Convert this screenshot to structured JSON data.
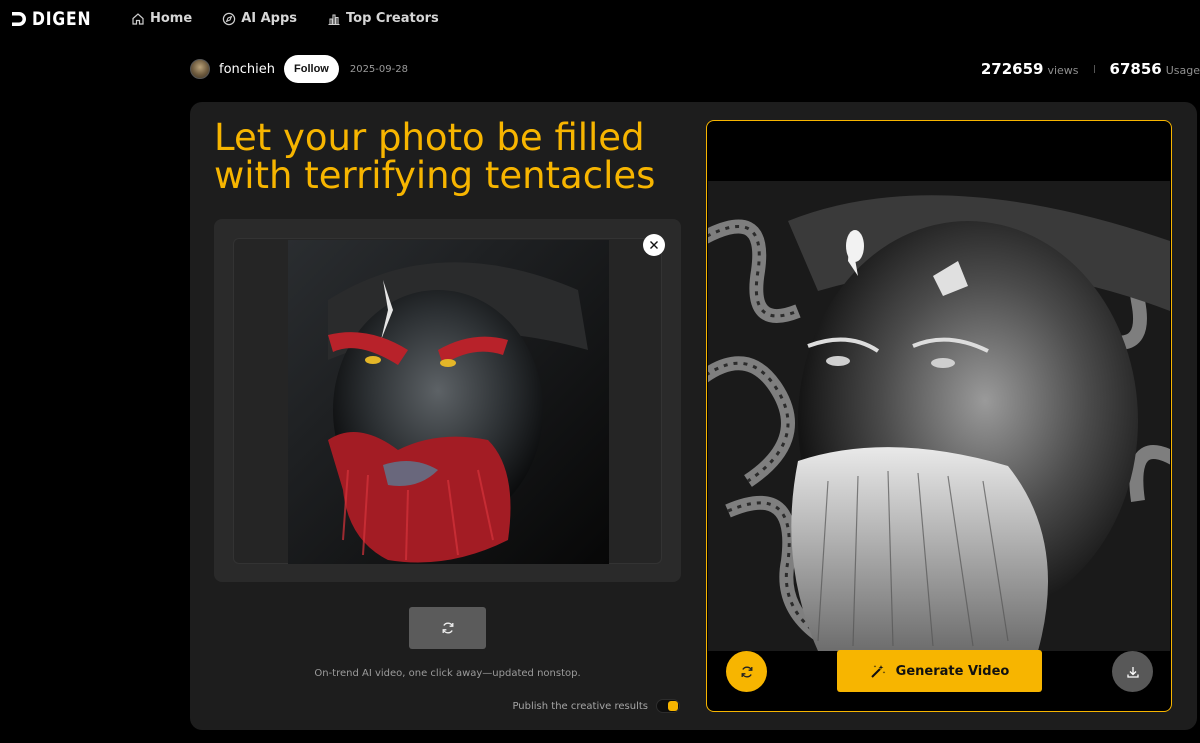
{
  "brand": {
    "name": "DIGEN"
  },
  "nav": {
    "items": [
      {
        "label": "Home",
        "icon": "home-icon"
      },
      {
        "label": "AI Apps",
        "icon": "compass-icon"
      },
      {
        "label": "Top Creators",
        "icon": "bar-chart-icon"
      }
    ]
  },
  "author": {
    "name": "fonchieh",
    "follow_label": "Follow",
    "date": "2025-09-28"
  },
  "stats": {
    "views": "272659",
    "views_label": "views",
    "usage": "67856",
    "usage_label": "Usage"
  },
  "card": {
    "title": "Let your photo be filled with terrifying tentacles",
    "tagline": "On-trend AI video, one click away—updated nonstop.",
    "publish_label": "Publish the creative results",
    "publish_enabled": true
  },
  "result": {
    "generate_label": "Generate Video"
  },
  "colors": {
    "accent": "#f7b500",
    "background": "#000000",
    "card": "#1d1d1d"
  }
}
